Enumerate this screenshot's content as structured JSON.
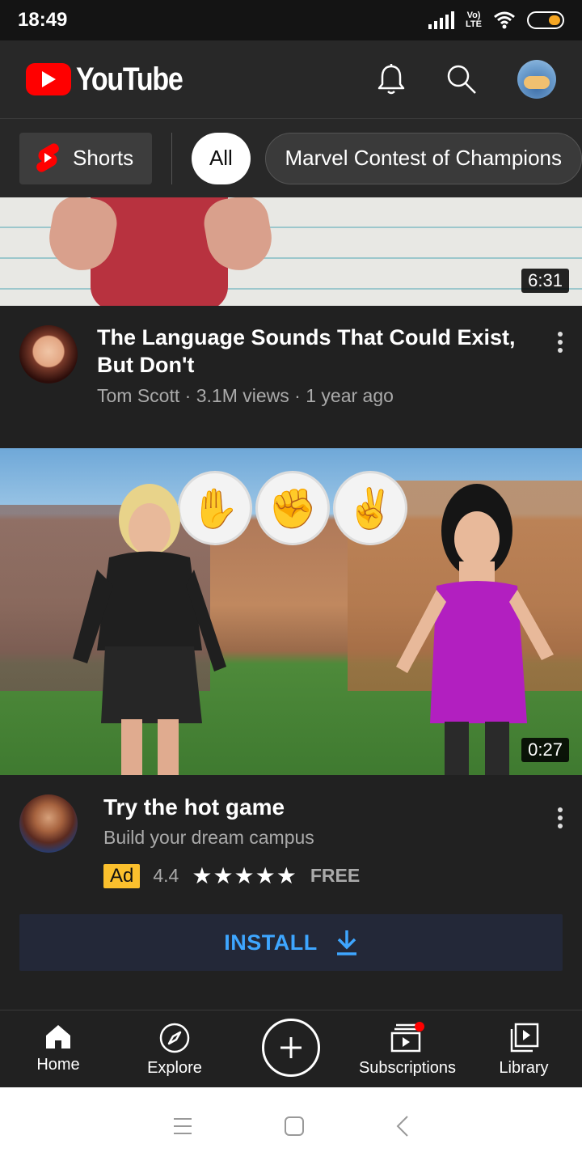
{
  "status_bar": {
    "time": "18:49",
    "lte_top": "Vo)",
    "lte_bottom": "LTE"
  },
  "app": {
    "logo_text": "YouTube"
  },
  "chips": {
    "shorts": "Shorts",
    "items": [
      "All",
      "Marvel Contest of Champions"
    ]
  },
  "videos": [
    {
      "duration": "6:31",
      "title": "The Language Sounds That Could Exist, But Don't",
      "channel": "Tom Scott",
      "views": "3.1M views",
      "age": "1 year ago"
    }
  ],
  "ad": {
    "duration": "0:27",
    "title": "Try the hot game",
    "description": "Build your dream campus",
    "badge": "Ad",
    "rating": "4.4",
    "stars": "★★★★★",
    "price": "FREE",
    "install_label": "INSTALL"
  },
  "bottom_nav": {
    "home": "Home",
    "explore": "Explore",
    "subscriptions": "Subscriptions",
    "library": "Library"
  },
  "colors": {
    "brand_red": "#ff0000",
    "link_blue": "#3ea6ff",
    "ad_badge": "#fbc02d",
    "notification_dot": "#ff0000"
  }
}
